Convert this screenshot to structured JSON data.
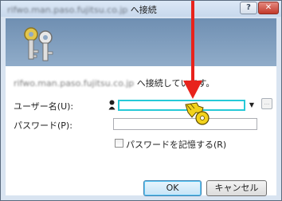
{
  "window": {
    "title_host": "rifwo.man.paso.fujitsu.co.jp",
    "title_suffix": "へ接続",
    "help_button_label": "?",
    "close_button_label": "✕",
    "banner_icon": "keys-icon"
  },
  "dialog": {
    "connecting_host": "rifwo.man.paso.fujitsu.co.jp",
    "connecting_suffix": "へ接続しています。",
    "username_label": "ユーザー名(U):",
    "username_value": "",
    "username_dropdown_symbol": "▼",
    "browse_button_label": "...",
    "password_label": "パスワード(P):",
    "password_value": "",
    "remember_label": "パスワードを記憶する(R)",
    "remember_checked": false,
    "ok_label": "OK",
    "cancel_label": "キャンセル"
  },
  "annotation": {
    "arrow_color": "#e8231c",
    "key_color": "#f2d21b",
    "icons": [
      "red-arrow-icon",
      "key-cursor-icon"
    ]
  }
}
